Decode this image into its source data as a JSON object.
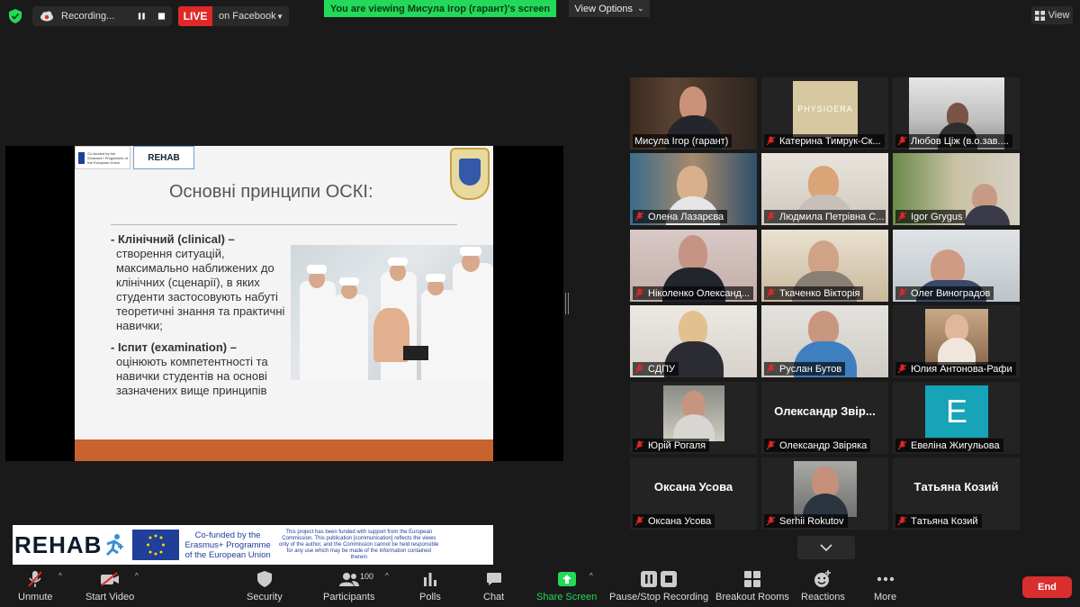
{
  "topbar": {
    "recording_label": "Recording...",
    "live_label": "LIVE",
    "facebook_label": "on Facebook",
    "viewing_banner": "You are viewing Мисула Ігор (гарант)'s screen",
    "view_options_label": "View Options",
    "view_label": "View"
  },
  "slide": {
    "title": "Основні принципи ОСКІ:",
    "rehab_logo": "REHAB",
    "eu_logo_text": "Co-funded by the Erasmus+ Programme of the European Union",
    "bullet1_head": "- Клінічний (clinical) –",
    "bullet1_body": "створення ситуацій, максимально наближених до клінічних (сценарії), в яких студенти застосовують набуті теоретичні знання та практичні навички;",
    "bullet2_head": "- Іспит (examination) –",
    "bullet2_body": "оцінюють компетентності та навички  студентів на основі зазначених вище принципів"
  },
  "participants": [
    {
      "name": "Мисула Ігор (гарант)",
      "muted": false,
      "active": true
    },
    {
      "name": "Катерина Тимрук-Ск...",
      "muted": true
    },
    {
      "name": "Любов Ціж (в.о.зав....",
      "muted": true
    },
    {
      "name": "Олена Лазарєва",
      "muted": true
    },
    {
      "name": "Людмила Петрівна С...",
      "muted": true
    },
    {
      "name": "Igor Grygus",
      "muted": true
    },
    {
      "name": "Ніколенко Олександ...",
      "muted": true
    },
    {
      "name": "Ткаченко Вікторія",
      "muted": true
    },
    {
      "name": "Олег Виноградов",
      "muted": true
    },
    {
      "name": "СДПУ",
      "muted": true
    },
    {
      "name": "Руслан Бутов",
      "muted": true
    },
    {
      "name": "Юлия Антонова-Рафи",
      "muted": true
    },
    {
      "name": "Юрій Рогаля",
      "muted": true
    },
    {
      "name": "Олександр Звіряка",
      "muted": true,
      "bigname": "Олександр  Звір..."
    },
    {
      "name": "Евеліна Жигульова",
      "muted": true,
      "avatar_letter": "E"
    },
    {
      "name": "Оксана Усова",
      "muted": true,
      "bigname": "Оксана Усова"
    },
    {
      "name": "Serhii Rokutov",
      "muted": true
    },
    {
      "name": "Тaтьяна Козий",
      "muted": true,
      "bigname": "Тaтьяна Козий"
    }
  ],
  "logos": {
    "physioera": "PHYSIOERA"
  },
  "banner": {
    "rehab": "REHAB",
    "cofund_line1": "Co-funded by the",
    "cofund_line2": "Erasmus+ Programme",
    "cofund_line3": "of the European Union",
    "disclaimer": "This project has been funded with support from the European Commission. This publication [communication] reflects the views only of the author, and the Commission cannot be held responsible for any use which may be made of the information contained therein"
  },
  "toolbar": {
    "unmute": "Unmute",
    "start_video": "Start Video",
    "security": "Security",
    "participants": "Participants",
    "participants_count": "100",
    "polls": "Polls",
    "chat": "Chat",
    "share_screen": "Share Screen",
    "pause_recording": "Pause/Stop Recording",
    "breakout": "Breakout Rooms",
    "reactions": "Reactions",
    "more": "More",
    "end": "End"
  },
  "colors": {
    "share_green": "#23d959",
    "live_red": "#e02828",
    "end_red": "#d92e2e",
    "active_speaker": "#c5dc30",
    "slide_footer": "#c8622e"
  }
}
